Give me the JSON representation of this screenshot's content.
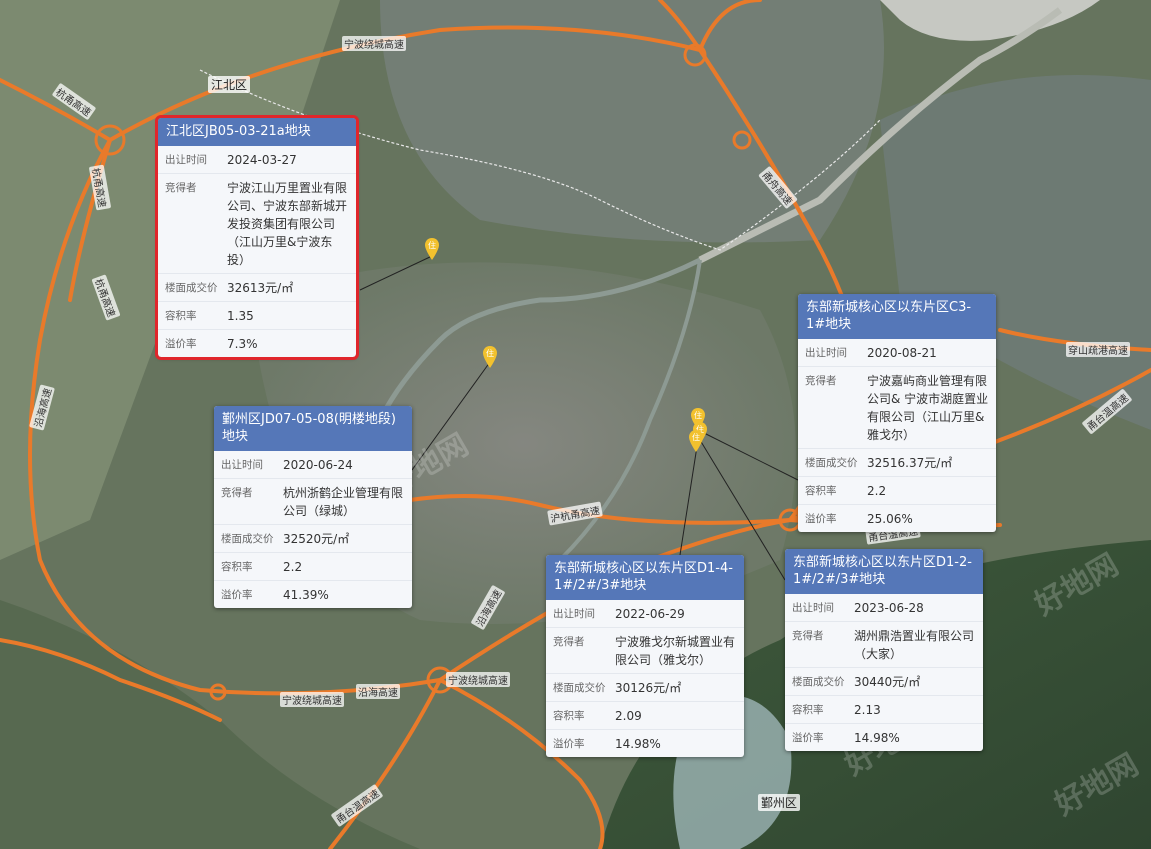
{
  "map": {
    "district_labels": [
      "江北区",
      "鄞州区"
    ],
    "road_labels": [
      "宁波绕城高速",
      "杭甬高速",
      "沪杭甬高速",
      "宁波绕城高速",
      "甬台温高速",
      "宁波绕城高速",
      "甬台温高速",
      "穿山疏港高速",
      "甬台温高速",
      "沿海高速",
      "杭甬高速",
      "杭甬高速",
      "甬舟高速",
      "沿海高速",
      "沿海高速"
    ],
    "pin_label": "住",
    "watermark": "好地网",
    "colors": {
      "road": "#e97a2a",
      "card_header": "#5577b8",
      "highlight_border": "#e0262b",
      "pin": "#f2c12e"
    }
  },
  "parcels": [
    {
      "title": "江北区JB05-03-21a地块",
      "highlighted": true,
      "rows": [
        {
          "label": "出让时间",
          "value": "2024-03-27"
        },
        {
          "label": "竞得者",
          "value": "宁波江山万里置业有限公司、宁波东部新城开发投资集团有限公司（江山万里&宁波东投）"
        },
        {
          "label": "楼面成交价",
          "value": "32613元/㎡"
        },
        {
          "label": "容积率",
          "value": "1.35"
        },
        {
          "label": "溢价率",
          "value": "7.3%"
        }
      ]
    },
    {
      "title": "鄞州区JD07-05-08(明楼地段)地块",
      "highlighted": false,
      "rows": [
        {
          "label": "出让时间",
          "value": "2020-06-24"
        },
        {
          "label": "竞得者",
          "value": "杭州浙鹤企业管理有限公司（绿城）"
        },
        {
          "label": "楼面成交价",
          "value": "32520元/㎡"
        },
        {
          "label": "容积率",
          "value": "2.2"
        },
        {
          "label": "溢价率",
          "value": "41.39%"
        }
      ]
    },
    {
      "title": "东部新城核心区以东片区C3-1#地块",
      "highlighted": false,
      "rows": [
        {
          "label": "出让时间",
          "value": "2020-08-21"
        },
        {
          "label": "竞得者",
          "value": "宁波嘉屿商业管理有限公司& 宁波市湖庭置业有限公司（江山万里&雅戈尔）"
        },
        {
          "label": "楼面成交价",
          "value": "32516.37元/㎡"
        },
        {
          "label": "容积率",
          "value": "2.2"
        },
        {
          "label": "溢价率",
          "value": "25.06%"
        }
      ]
    },
    {
      "title": "东部新城核心区以东片区D1-4-1#/2#/3#地块",
      "highlighted": false,
      "rows": [
        {
          "label": "出让时间",
          "value": "2022-06-29"
        },
        {
          "label": "竞得者",
          "value": "宁波雅戈尔新城置业有限公司（雅戈尔）"
        },
        {
          "label": "楼面成交价",
          "value": "30126元/㎡"
        },
        {
          "label": "容积率",
          "value": "2.09"
        },
        {
          "label": "溢价率",
          "value": "14.98%"
        }
      ]
    },
    {
      "title": "东部新城核心区以东片区D1-2-1#/2#/3#地块",
      "highlighted": false,
      "rows": [
        {
          "label": "出让时间",
          "value": "2023-06-28"
        },
        {
          "label": "竞得者",
          "value": "湖州鼎浩置业有限公司（大家）"
        },
        {
          "label": "楼面成交价",
          "value": "30440元/㎡"
        },
        {
          "label": "容积率",
          "value": "2.13"
        },
        {
          "label": "溢价率",
          "value": "14.98%"
        }
      ]
    }
  ]
}
